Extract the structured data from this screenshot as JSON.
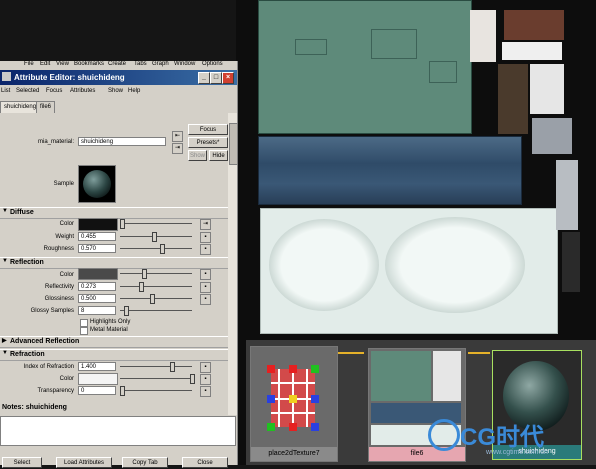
{
  "window": {
    "title": "Attribute Editor: shuichideng",
    "main_menu": [
      "File",
      "Edit",
      "View",
      "Bookmarks",
      "Create",
      "Tabs",
      "Graph",
      "Window",
      "Options"
    ]
  },
  "menu": [
    "List",
    "Selected",
    "Focus",
    "Attributes",
    "Show",
    "Help"
  ],
  "tabs": [
    "shuichideng",
    "file6"
  ],
  "header": {
    "material_label": "mia_material:",
    "material_value": "shuichideng",
    "focus_label": "Focus",
    "presets_label": "Presets*",
    "show_label": "Show",
    "hide_label": "Hide",
    "sample_label": "Sample"
  },
  "diffuse": {
    "title": "Diffuse",
    "color_label": "Color",
    "weight_label": "Weight",
    "weight_value": "0.455",
    "roughness_label": "Roughness",
    "roughness_value": "0.570"
  },
  "reflection": {
    "title": "Reflection",
    "color_label": "Color",
    "reflectivity_label": "Reflectivity",
    "reflectivity_value": "0.273",
    "glossiness_label": "Glossiness",
    "glossiness_value": "0.500",
    "glossy_samples_label": "Glossy Samples",
    "glossy_samples_value": "8",
    "highlights_only_label": "Highlights Only",
    "metal_material_label": "Metal Material"
  },
  "advanced_reflection": {
    "title": "Advanced Reflection"
  },
  "refraction": {
    "title": "Refraction",
    "ior_label": "Index of Refraction",
    "ior_value": "1.400",
    "color_label": "Color",
    "transparency_label": "Transparency",
    "transparency_value": "0"
  },
  "notes": {
    "label": "Notes: shuichideng"
  },
  "buttons": {
    "select": "Select",
    "load_attributes": "Load Attributes",
    "copy_tab": "Copy Tab",
    "close": "Close"
  },
  "hypershade": {
    "node1": "place2dTexture7",
    "node2": "file6",
    "node3": "shuichideng"
  },
  "watermark": {
    "text": "CG时代",
    "url": "www.cgtime.com.cn"
  },
  "colors": {
    "diffuse_color": "#111111",
    "reflection_color": "#4a4a4a",
    "refraction_color": "#f4f4f4"
  }
}
